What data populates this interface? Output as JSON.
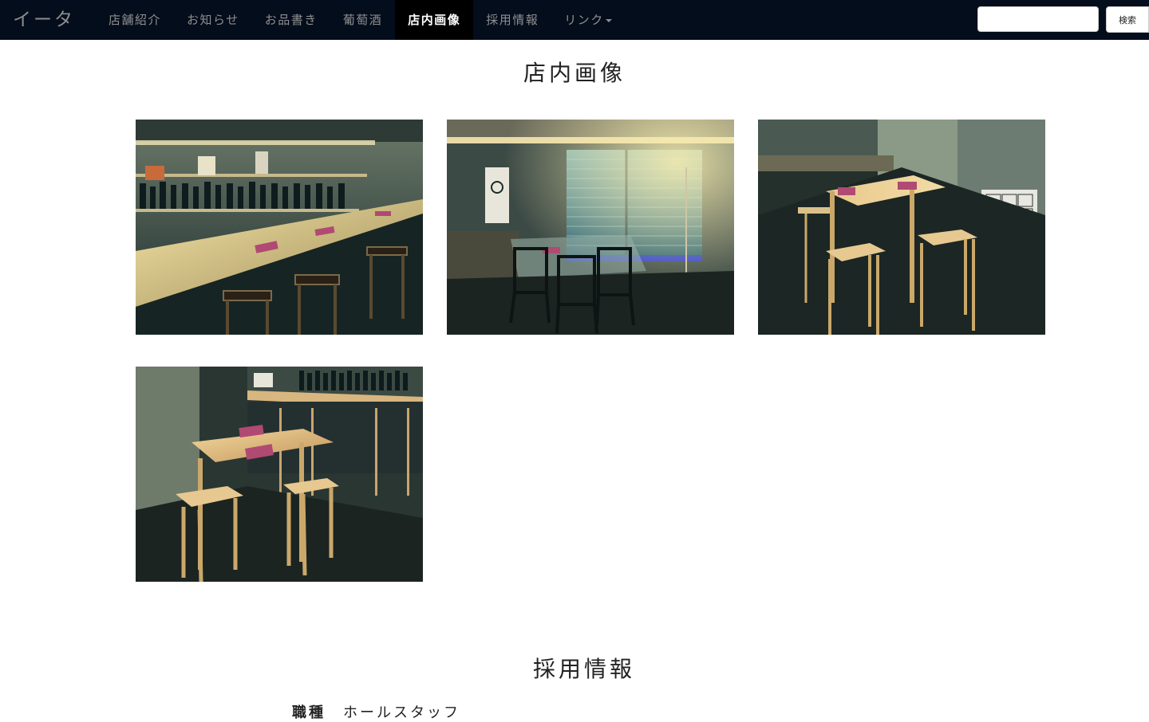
{
  "navbar": {
    "brand": "イータ",
    "items": [
      {
        "label": "店舗紹介",
        "active": false
      },
      {
        "label": "お知らせ",
        "active": false
      },
      {
        "label": "お品書き",
        "active": false
      },
      {
        "label": "葡萄酒",
        "active": false
      },
      {
        "label": "店内画像",
        "active": true
      },
      {
        "label": "採用情報",
        "active": false
      },
      {
        "label": "リンク",
        "active": false,
        "dropdown": true
      }
    ],
    "search": {
      "placeholder": "",
      "value": "",
      "button_label": "検索"
    }
  },
  "gallery": {
    "title": "店内画像",
    "photos": [
      {
        "subject": "counter-bar-with-wine-shelves"
      },
      {
        "subject": "glass-table-by-window"
      },
      {
        "subject": "high-table-with-stools"
      },
      {
        "subject": "high-table-near-counter"
      }
    ]
  },
  "recruit": {
    "title": "採用情報",
    "job_label": "職種",
    "job_value": "ホールスタッフ"
  },
  "colors": {
    "navbar_bg": "#040d1c",
    "nav_active_bg": "#000000",
    "nav_text": "#8f8f8f"
  }
}
